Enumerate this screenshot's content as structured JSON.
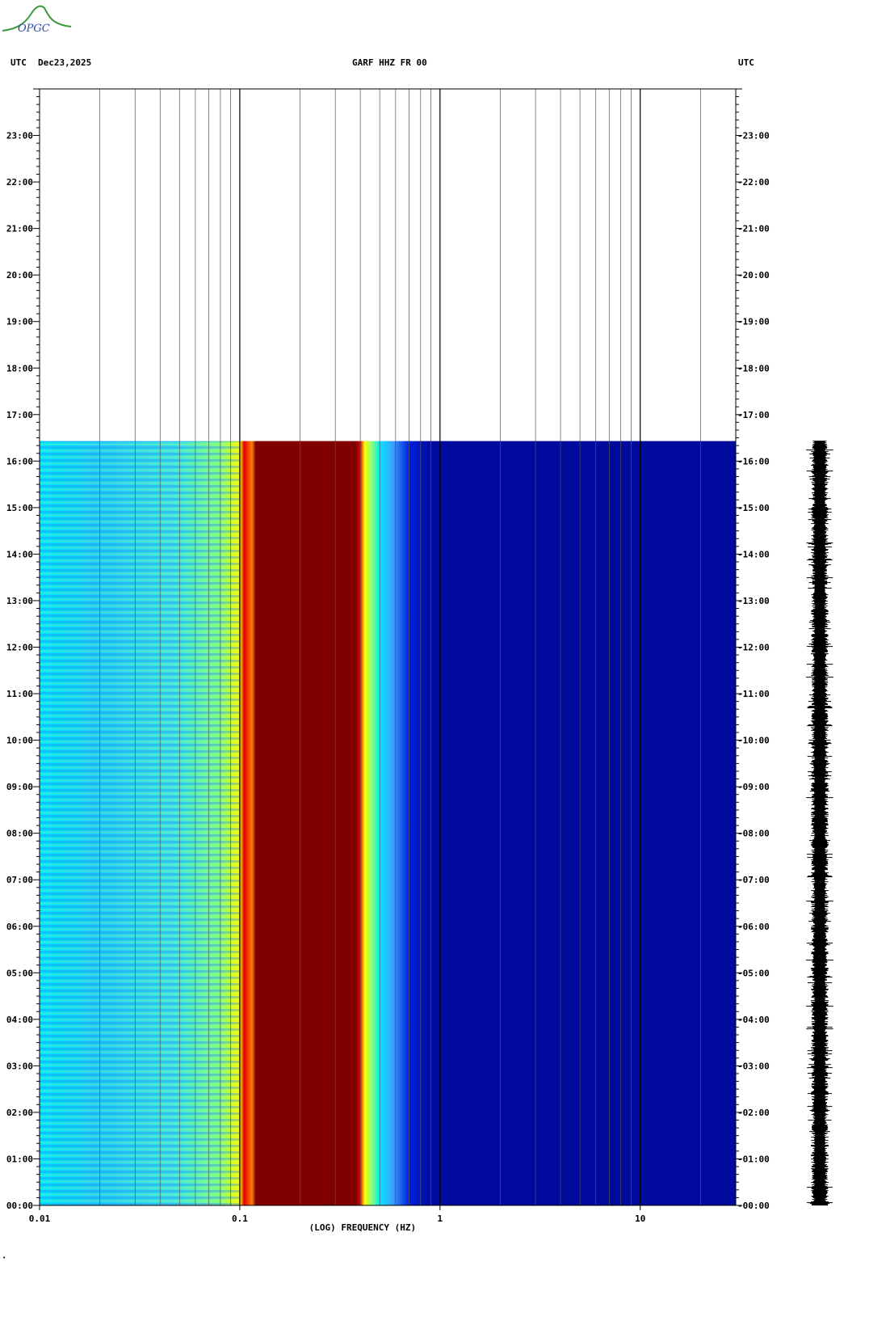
{
  "header": {
    "left_tz": "UTC",
    "date": "Dec23,2025",
    "station": "GARF HHZ FR 00",
    "right_tz": "UTC"
  },
  "logo": {
    "text": "OPGC"
  },
  "colors": {
    "dark_red": "#800000",
    "red": "#e00000",
    "orange": "#ff8000",
    "yellow": "#ffff00",
    "cyan": "#00e8ff",
    "light_blue": "#3ca0ff",
    "blue": "#0020e0",
    "navy": "#000a9c"
  },
  "chart_data": {
    "type": "heatmap",
    "title": "GARF HHZ FR 00",
    "xlabel": "(LOG) FREQUENCY (HZ)",
    "x_scale": "log",
    "xlim": [
      0.01,
      30
    ],
    "x_ticks": [
      {
        "value": 0.01,
        "label": "0.01"
      },
      {
        "value": 0.1,
        "label": "0.1"
      },
      {
        "value": 1,
        "label": "1"
      },
      {
        "value": 10,
        "label": "10"
      }
    ],
    "y_ticks_left": [
      "23:00",
      "22:00",
      "21:00",
      "20:00",
      "19:00",
      "18:00",
      "17:00",
      "16:00",
      "15:00",
      "14:00",
      "13:00",
      "12:00",
      "11:00",
      "10:00",
      "09:00",
      "08:00",
      "07:00",
      "06:00",
      "05:00",
      "04:00",
      "03:00",
      "02:00",
      "01:00",
      "00:00"
    ],
    "y_ticks_right": [
      "23:00",
      "22:00",
      "21:00",
      "20:00",
      "19:00",
      "18:00",
      "17:00",
      "16:00",
      "15:00",
      "14:00",
      "13:00",
      "12:00",
      "11:00",
      "10:00",
      "09:00",
      "08:00",
      "07:00",
      "06:00",
      "05:00",
      "04:00",
      "03:00",
      "02:00",
      "01:00",
      "00:00"
    ],
    "ylim_hours": [
      0,
      24
    ],
    "data_end_hour": 16.43,
    "bands": [
      {
        "from": 0.01,
        "to": 0.1,
        "level": "cyan / light blue, mixed yellow-green"
      },
      {
        "from": 0.1,
        "to": 0.12,
        "level": "red / orange / yellow"
      },
      {
        "from": 0.12,
        "to": 0.4,
        "level": "dark red (maximum)"
      },
      {
        "from": 0.4,
        "to": 0.5,
        "level": "yellow / green"
      },
      {
        "from": 0.5,
        "to": 0.7,
        "level": "light blue / blue"
      },
      {
        "from": 0.7,
        "to": 30,
        "level": "navy (minimum)"
      }
    ]
  }
}
